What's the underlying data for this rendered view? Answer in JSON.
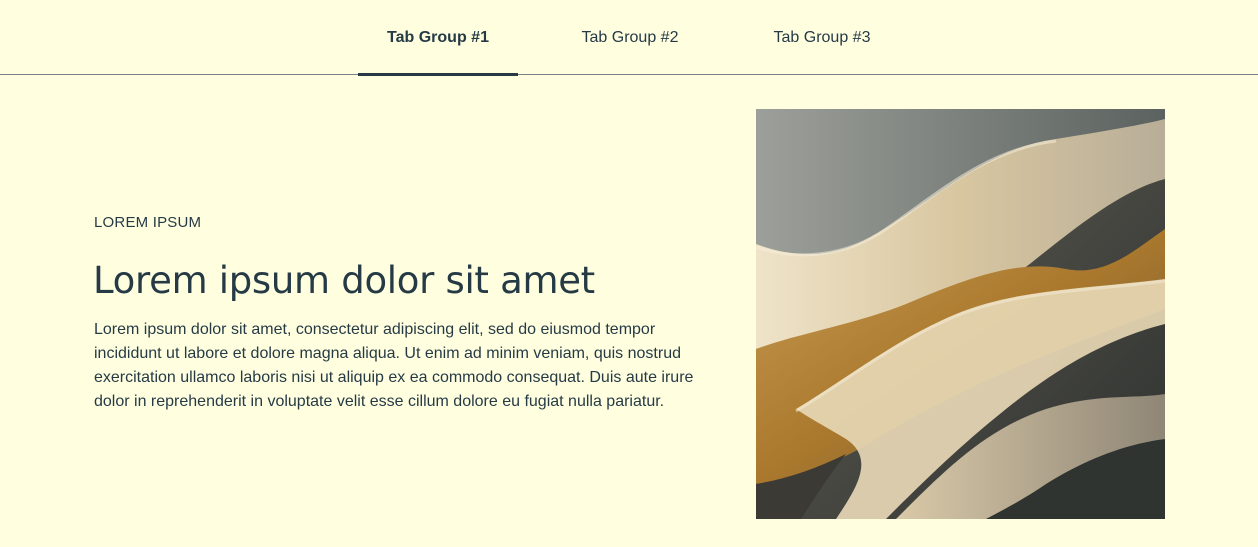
{
  "tabs": [
    {
      "label": "Tab Group #1",
      "active": true
    },
    {
      "label": "Tab Group #2",
      "active": false
    },
    {
      "label": "Tab Group #3",
      "active": false
    }
  ],
  "content": {
    "eyebrow": "LOREM IPSUM",
    "headline": "Lorem ipsum dolor sit amet",
    "body": "Lorem ipsum dolor sit amet, consectetur adipiscing elit, sed do eiusmod tempor incididunt ut labore et dolore magna aliqua. Ut enim ad minim veniam, quis nostrud exercitation ullamco laboris nisi ut aliquip ex ea commodo consequat. Duis aute irure dolor in reprehenderit in voluptate velit esse cillum dolore eu fugiat nulla pariatur."
  },
  "colors": {
    "background": "#ffffe0",
    "text": "#263a46",
    "divider": "#7b8286"
  }
}
